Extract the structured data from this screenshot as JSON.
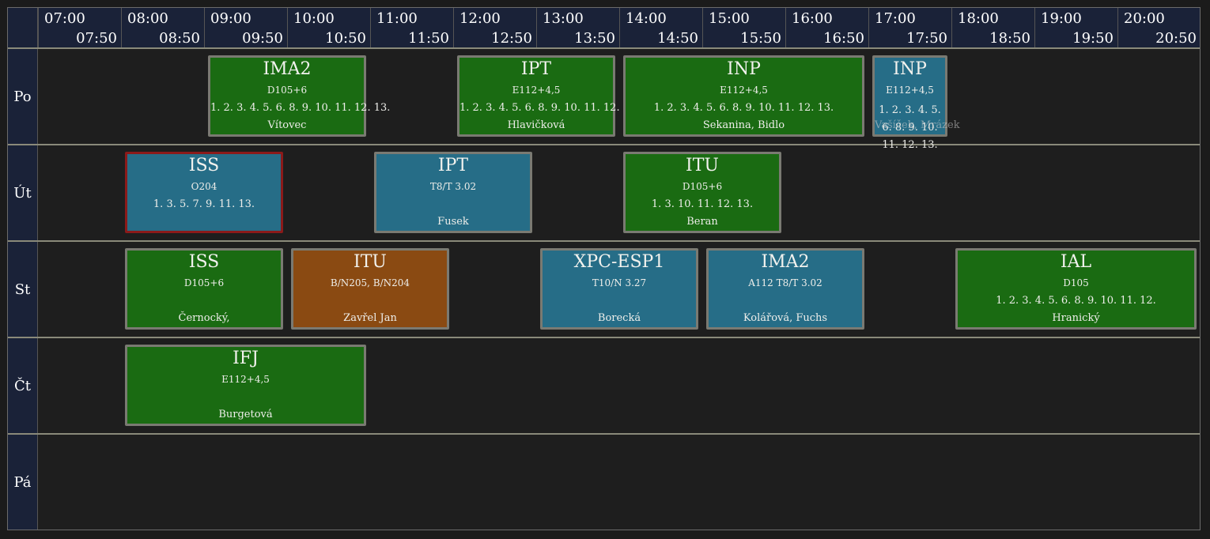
{
  "hours": [
    {
      "start": "07:00",
      "end": "07:50"
    },
    {
      "start": "08:00",
      "end": "08:50"
    },
    {
      "start": "09:00",
      "end": "09:50"
    },
    {
      "start": "10:00",
      "end": "10:50"
    },
    {
      "start": "11:00",
      "end": "11:50"
    },
    {
      "start": "12:00",
      "end": "12:50"
    },
    {
      "start": "13:00",
      "end": "13:50"
    },
    {
      "start": "14:00",
      "end": "14:50"
    },
    {
      "start": "15:00",
      "end": "15:50"
    },
    {
      "start": "16:00",
      "end": "16:50"
    },
    {
      "start": "17:00",
      "end": "17:50"
    },
    {
      "start": "18:00",
      "end": "18:50"
    },
    {
      "start": "19:00",
      "end": "19:50"
    },
    {
      "start": "20:00",
      "end": "20:50"
    }
  ],
  "days": [
    "Po",
    "Út",
    "St",
    "Čt",
    "Pá"
  ],
  "colors": {
    "green": "#1a6b12",
    "blue": "#266d87",
    "orange": "#8a4a12",
    "header": "#1a2238",
    "highlight_border": "#8b1a1a"
  },
  "events": [
    {
      "day": 0,
      "start": 9,
      "end": 11,
      "color": "green",
      "code": "IMA2",
      "room": "D105+6",
      "weeks": "1. 2. 3. 4. 5. 6. 8. 9. 10. 11. 12. 13.",
      "teacher": "Vítovec"
    },
    {
      "day": 0,
      "start": 12,
      "end": 14,
      "color": "green",
      "code": "IPT",
      "room": "E112+4,5",
      "weeks": "1. 2. 3. 4. 5. 6. 8. 9. 10. 11. 12. 13.",
      "teacher": "Hlavičková"
    },
    {
      "day": 0,
      "start": 14,
      "end": 17,
      "color": "green",
      "code": "INP",
      "room": "E112+4,5",
      "weeks": "1. 2. 3. 4. 5. 6. 8. 9. 10. 11. 12. 13.",
      "teacher": "Sekanina, Bidlo"
    },
    {
      "day": 0,
      "start": 17,
      "end": 18,
      "color": "blue",
      "code": "INP",
      "room": "E112+4,5",
      "weeks": "1. 2. 3. 4. 5. 6. 8. 9. 10. 11. 12. 13.",
      "teacher": "Vašíček, Mrázek",
      "narrow": true
    },
    {
      "day": 1,
      "start": 8,
      "end": 10,
      "color": "blue",
      "code": "ISS",
      "room": "O204",
      "weeks": "1. 3. 5. 7. 9. 11. 13.",
      "teacher": "",
      "highlight": true
    },
    {
      "day": 1,
      "start": 11,
      "end": 13,
      "color": "blue",
      "code": "IPT",
      "room": "T8/T 3.02",
      "weeks": "",
      "teacher": "Fusek"
    },
    {
      "day": 1,
      "start": 14,
      "end": 16,
      "color": "green",
      "code": "ITU",
      "room": "D105+6",
      "weeks": "1. 3. 10. 11. 12. 13.",
      "teacher": "Beran"
    },
    {
      "day": 2,
      "start": 8,
      "end": 10,
      "color": "green",
      "code": "ISS",
      "room": "D105+6",
      "weeks": "",
      "teacher": "Černocký,"
    },
    {
      "day": 2,
      "start": 10,
      "end": 12,
      "color": "orange",
      "code": "ITU",
      "room": "B/N205, B/N204",
      "weeks": "",
      "teacher": "Zavřel Jan"
    },
    {
      "day": 2,
      "start": 13,
      "end": 15,
      "color": "blue",
      "code": "XPC-ESP1",
      "room": "T10/N 3.27",
      "weeks": "",
      "teacher": "Borecká"
    },
    {
      "day": 2,
      "start": 15,
      "end": 17,
      "color": "blue",
      "code": "IMA2",
      "room": "A112 T8/T 3.02",
      "weeks": "",
      "teacher": "Kolářová, Fuchs"
    },
    {
      "day": 2,
      "start": 18,
      "end": 21,
      "color": "green",
      "code": "IAL",
      "room": "D105",
      "weeks": "1. 2. 3. 4. 5. 6. 8. 9. 10. 11. 12.",
      "teacher": "Hranický"
    },
    {
      "day": 3,
      "start": 8,
      "end": 11,
      "color": "green",
      "code": "IFJ",
      "room": "E112+4,5",
      "weeks": "",
      "teacher": "Burgetová"
    }
  ]
}
